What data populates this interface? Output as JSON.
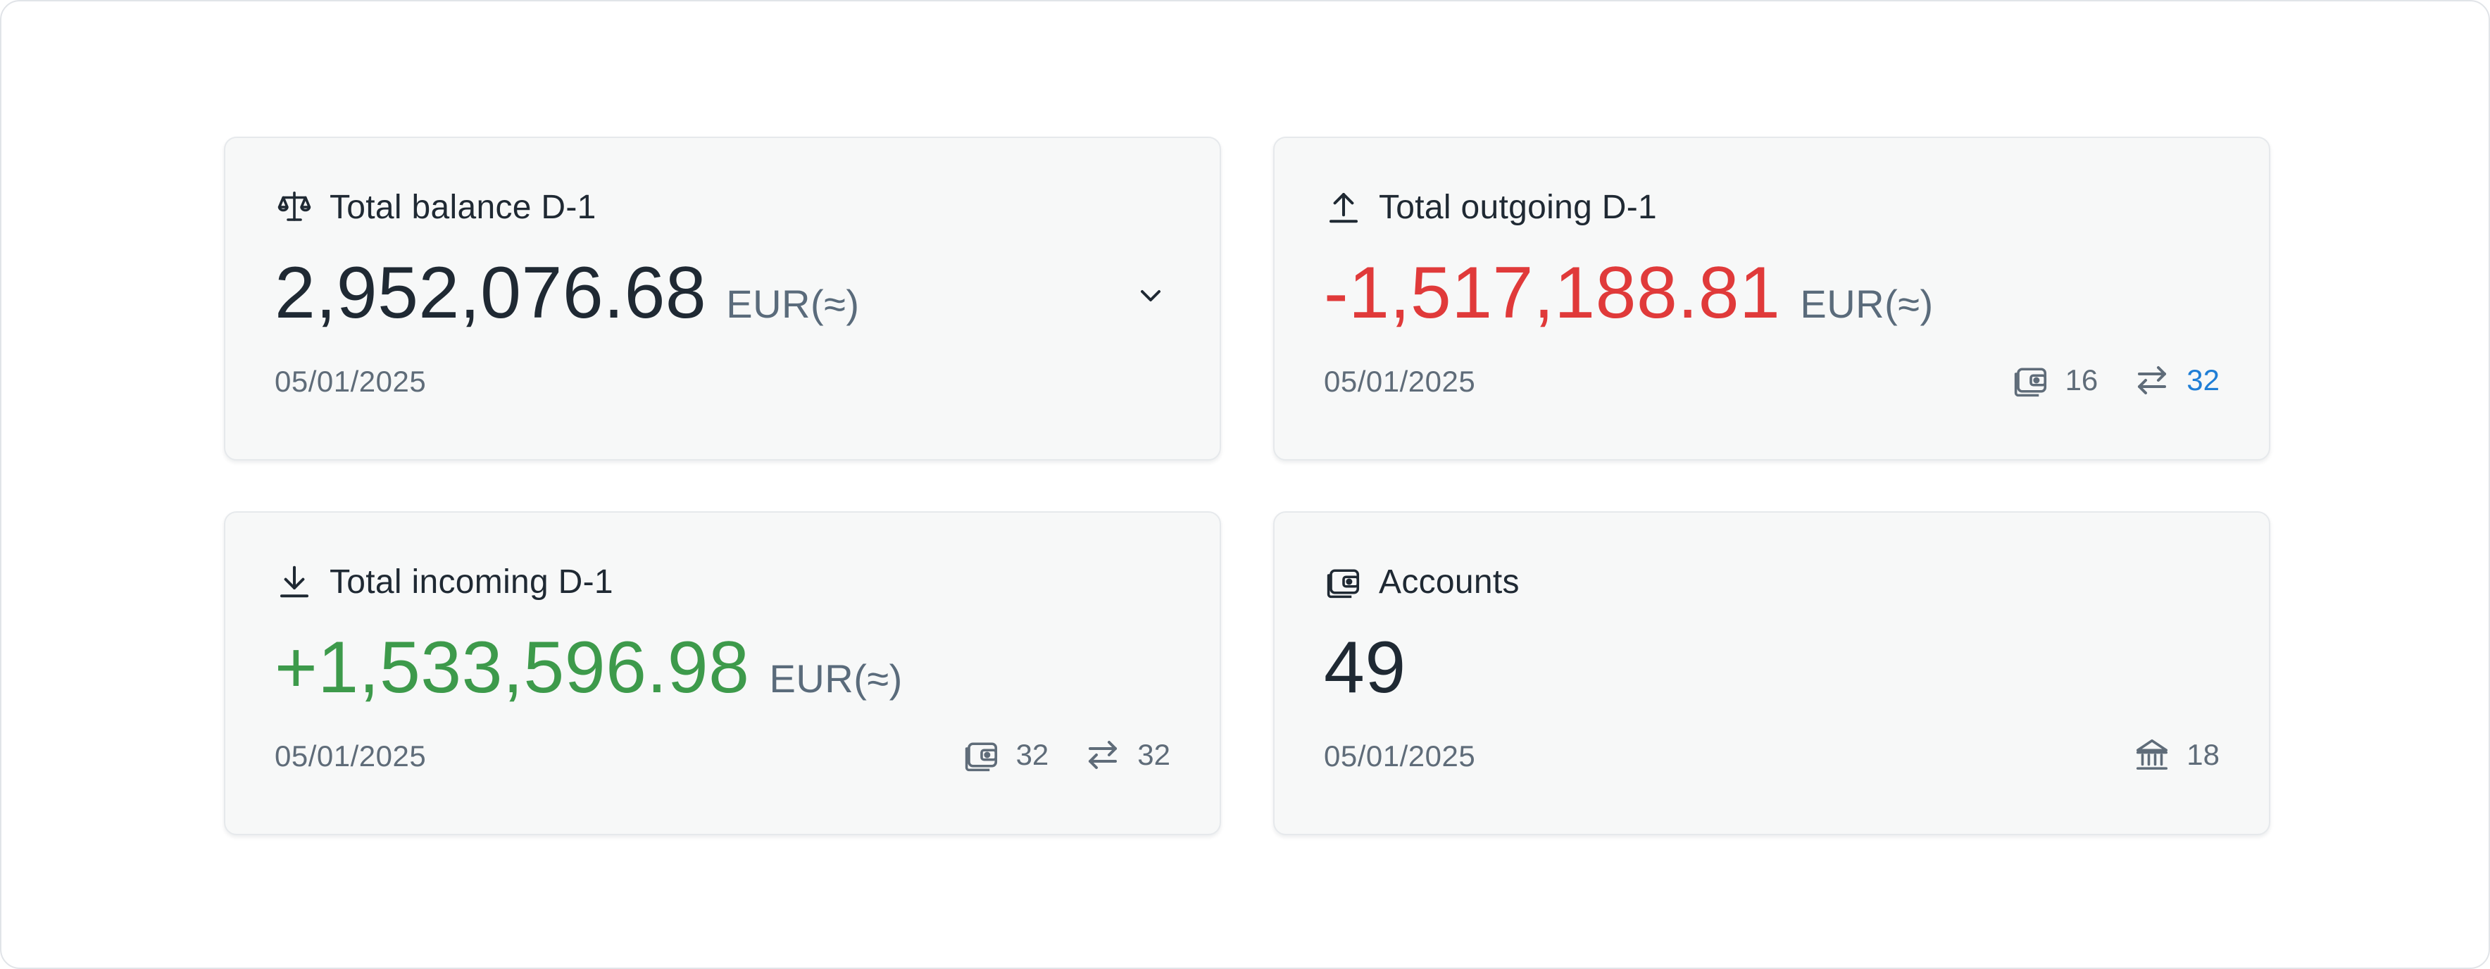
{
  "colors": {
    "negative": "#e03a3a",
    "positive": "#3d9a4b",
    "link": "#1f7ed6",
    "text": "#1f2933",
    "muted": "#5f6c79"
  },
  "cards": {
    "balance": {
      "title": "Total balance D-1",
      "icon": "scale-icon",
      "amount": "2,952,076.68",
      "currency": "EUR(≈)",
      "date": "05/01/2025",
      "expand_icon": "chevron-down-icon"
    },
    "outgoing": {
      "title": "Total outgoing D-1",
      "icon": "upload-arrow-icon",
      "amount": "-1,517,188.81",
      "currency": "EUR(≈)",
      "date": "05/01/2025",
      "accounts_count": "16",
      "transactions_count": "32"
    },
    "incoming": {
      "title": "Total incoming D-1",
      "icon": "download-arrow-icon",
      "amount": "+1,533,596.98",
      "currency": "EUR(≈)",
      "date": "05/01/2025",
      "accounts_count": "32",
      "transactions_count": "32"
    },
    "accounts": {
      "title": "Accounts",
      "icon": "wallet-icon",
      "amount": "49",
      "date": "05/01/2025",
      "banks_count": "18"
    }
  }
}
